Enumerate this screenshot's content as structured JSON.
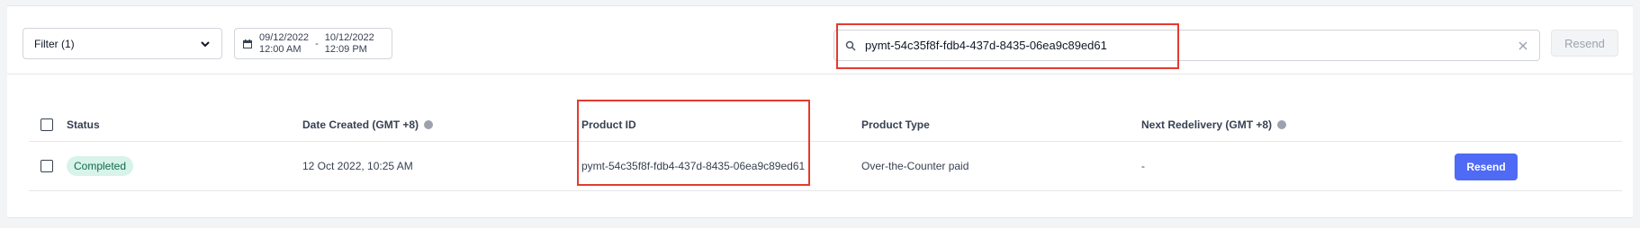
{
  "toolbar": {
    "filter_label": "Filter (1)",
    "date_start_date": "09/12/2022",
    "date_start_time": "12:00 AM",
    "date_separator": "-",
    "date_end_date": "10/12/2022",
    "date_end_time": "12:09 PM",
    "search_value": "pymt-54c35f8f-fdb4-437d-8435-06ea9c89ed61",
    "resend_label": "Resend"
  },
  "table": {
    "headers": [
      "Status",
      "Date Created (GMT +8)",
      "Product ID",
      "Product Type",
      "Next Redelivery (GMT +8)"
    ],
    "rows": [
      {
        "status": "Completed",
        "date_created": "12 Oct 2022, 10:25 AM",
        "product_id": "pymt-54c35f8f-fdb4-437d-8435-06ea9c89ed61",
        "product_type": "Over-the-Counter paid",
        "next_redelivery": "-",
        "action_label": "Resend"
      }
    ]
  },
  "colors": {
    "highlight": "#e33b2e",
    "primary_button": "#4f6af5",
    "badge_bg": "#d7f3ea",
    "badge_text": "#116a4b"
  }
}
